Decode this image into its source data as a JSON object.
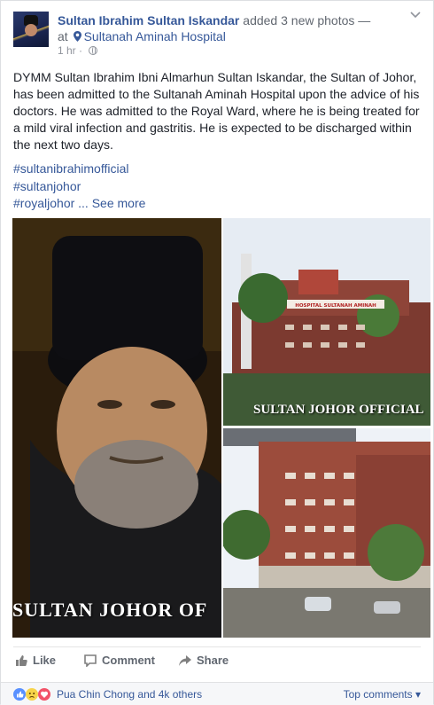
{
  "post": {
    "author": "Sultan Ibrahim Sultan Iskandar",
    "action": "added 3 new photos —",
    "at": "at",
    "place": "Sultanah Aminah Hospital",
    "time": "1 hr ·",
    "body": "DYMM Sultan Ibrahim Ibni Almarhun Sultan Iskandar, the Sultan of Johor, has been admitted to the Sultanah Aminah Hospital upon the advice of his doctors. He was admitted to the Royal Ward, where he is being treated for a mild viral infection and gastritis. He is expected to be discharged within the next two days.",
    "hashtags": [
      "#sultanibrahimofficial",
      "#sultanjohor",
      "#royaljohor"
    ],
    "ellipsis": " ...",
    "see_more": "See more"
  },
  "photos": {
    "main_overlay": "SULTAN JOHOR OF",
    "top_right_overlay": "SULTAN JOHOR OFFICIAL",
    "hospital_sign": "HOSPITAL SULTANAH AMINAH"
  },
  "actions": {
    "like": "Like",
    "comment": "Comment",
    "share": "Share"
  },
  "reactions": {
    "summary": "Pua Chin Chong and 4k others",
    "top_comments": "Top comments ▾"
  },
  "icons": [
    "pin-icon",
    "globe-icon",
    "chevron-down-icon",
    "like-icon",
    "comment-icon",
    "share-icon",
    "like-reaction-icon",
    "sad-reaction-icon",
    "love-reaction-icon"
  ]
}
